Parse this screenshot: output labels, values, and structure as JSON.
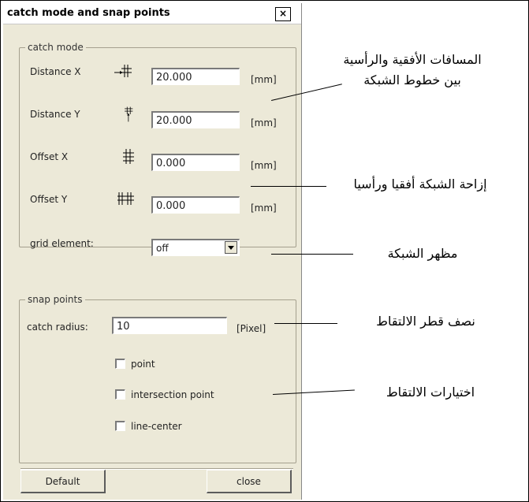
{
  "dialog": {
    "title": "catch mode and snap points",
    "close_glyph": "×"
  },
  "catch_mode": {
    "legend": "catch mode",
    "distance_x": {
      "label": "Distance X",
      "value": "20.000",
      "unit": "[mm]"
    },
    "distance_y": {
      "label": "Distance Y",
      "value": "20.000",
      "unit": "[mm]"
    },
    "offset_x": {
      "label": "Offset X",
      "value": "0.000",
      "unit": "[mm]"
    },
    "offset_y": {
      "label": "Offset Y",
      "value": "0.000",
      "unit": "[mm]"
    },
    "grid_element": {
      "label": "grid element:",
      "value": "off"
    }
  },
  "snap_points": {
    "legend": "snap points",
    "catch_radius": {
      "label": "catch radius:",
      "value": "10",
      "unit": "[Pixel]"
    },
    "options": [
      {
        "label": "point",
        "checked": false
      },
      {
        "label": "intersection point",
        "checked": false
      },
      {
        "label": "line-center",
        "checked": false
      }
    ]
  },
  "buttons": {
    "default": "Default",
    "close": "close"
  },
  "annotations": {
    "distances_line1": "المسافات الأفقية والرأسية",
    "distances_line2": "بين خطوط الشبكة",
    "offset": "إزاحة الشبكة أفقيا ورأسيا",
    "grid_appearance": "مظهر الشبكة",
    "catch_radius": "نصف قطر الالتقاط",
    "snap_options": "اختيارات الالتقاط"
  },
  "colors": {
    "dialog_background": "#ece9d8",
    "group_border": "#a5a08e"
  }
}
